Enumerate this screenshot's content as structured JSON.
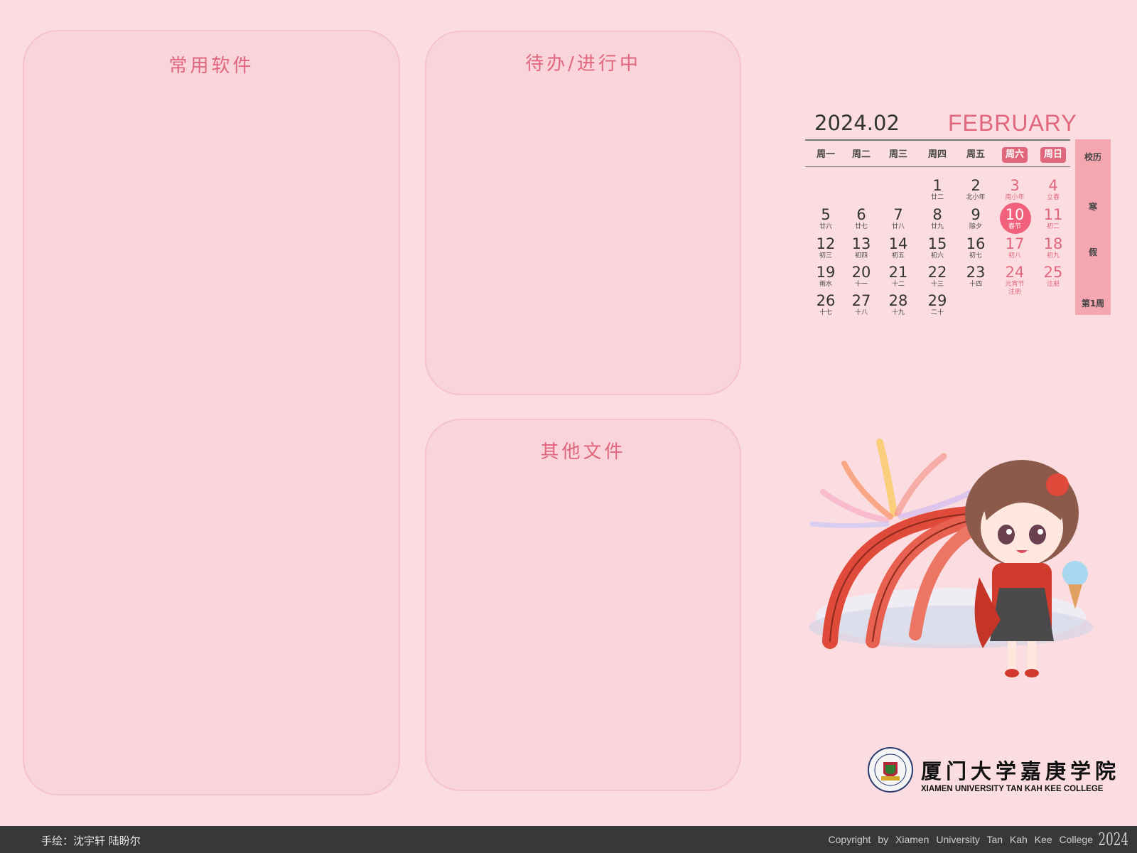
{
  "panels": {
    "software_title": "常用软件",
    "todo_title": "待办/进行中",
    "other_title": "其他文件"
  },
  "calendar": {
    "year_month": "2024.02",
    "month_name": "FEBRUARY",
    "weekdays": [
      "周一",
      "周二",
      "周三",
      "周四",
      "周五",
      "周六",
      "周日"
    ],
    "days": [
      {
        "d": "1",
        "sub": "廿二"
      },
      {
        "d": "2",
        "sub": "北小年"
      },
      {
        "d": "3",
        "sub": "南小年"
      },
      {
        "d": "4",
        "sub": "立春"
      },
      {
        "d": "5",
        "sub": "廿六"
      },
      {
        "d": "6",
        "sub": "廿七"
      },
      {
        "d": "7",
        "sub": "廿八"
      },
      {
        "d": "8",
        "sub": "廿九"
      },
      {
        "d": "9",
        "sub": "除夕"
      },
      {
        "d": "10",
        "sub": "春节"
      },
      {
        "d": "11",
        "sub": "初二"
      },
      {
        "d": "12",
        "sub": "初三"
      },
      {
        "d": "13",
        "sub": "初四"
      },
      {
        "d": "14",
        "sub": "初五"
      },
      {
        "d": "15",
        "sub": "初六"
      },
      {
        "d": "16",
        "sub": "初七"
      },
      {
        "d": "17",
        "sub": "初八"
      },
      {
        "d": "18",
        "sub": "初九"
      },
      {
        "d": "19",
        "sub": "雨水"
      },
      {
        "d": "20",
        "sub": "十一"
      },
      {
        "d": "21",
        "sub": "十二"
      },
      {
        "d": "22",
        "sub": "十三"
      },
      {
        "d": "23",
        "sub": "十四"
      },
      {
        "d": "24",
        "sub": "元宵节",
        "sub2": "注册"
      },
      {
        "d": "25",
        "sub": "注册"
      },
      {
        "d": "26",
        "sub": "十七"
      },
      {
        "d": "27",
        "sub": "十八"
      },
      {
        "d": "28",
        "sub": "十九"
      },
      {
        "d": "29",
        "sub": "二十"
      }
    ],
    "today": "10",
    "side": {
      "label1": "校历",
      "label2": "寒",
      "label3": "假",
      "week": "第1周"
    }
  },
  "logo": {
    "cn": "厦门大学嘉庚学院",
    "en": "XIAMEN UNIVERSITY TAN KAH KEE COLLEGE"
  },
  "footer": {
    "left": "手绘：沈宇轩 陆盼尔",
    "right": "Copyright by Xiamen University Tan Kah Kee College",
    "year": "2024"
  },
  "colors": {
    "background": "#fbdde1",
    "accent": "#e0667c",
    "today": "#f2617b",
    "footer": "#383838"
  }
}
